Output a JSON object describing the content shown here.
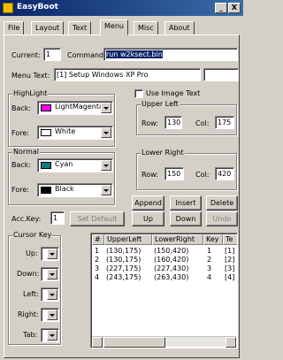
{
  "window": {
    "title": "EasyBoot",
    "minimize": "_",
    "close": "X"
  },
  "tabs": [
    "File",
    "Layout",
    "Text",
    "Menu",
    "Misc",
    "About"
  ],
  "current": {
    "label": "Current:",
    "value": "1"
  },
  "command": {
    "label": "Command:",
    "value": "run w2ksect.bin"
  },
  "menu_text": {
    "label": "Menu Text:",
    "value": "[1] Setup Windows XP Pro"
  },
  "highlight": {
    "title": "HighLight",
    "back_label": "Back:",
    "back_value": "LightMagenta",
    "back_color": "#ff00ff",
    "fore_label": "Fore:",
    "fore_value": "White",
    "fore_color": "#ffffff"
  },
  "use_image_text": {
    "label": "Use Image Text"
  },
  "upper_left": {
    "title": "Upper Left",
    "row_label": "Row:",
    "row_value": "130",
    "col_label": "Col:",
    "col_value": "175"
  },
  "normal": {
    "title": "Normal",
    "back_label": "Back:",
    "back_value": "Cyan",
    "back_color": "#008080",
    "fore_label": "Fore:",
    "fore_value": "Black",
    "fore_color": "#000000"
  },
  "lower_right": {
    "title": "Lower Right",
    "row_label": "Row:",
    "row_value": "150",
    "col_label": "Col:",
    "col_value": "420"
  },
  "buttons": {
    "append": "Append",
    "insert": "Insert",
    "delete": "Delete",
    "set_default": "Set Default",
    "up": "Up",
    "down": "Down",
    "undo": "Undo"
  },
  "acc_key": {
    "label": "Acc.Key:",
    "value": "1"
  },
  "cursor_key": {
    "title": "Cursor Key",
    "items": [
      {
        "label": "Up:"
      },
      {
        "label": "Down:"
      },
      {
        "label": "Left:"
      },
      {
        "label": "Right:"
      },
      {
        "label": "Tab:"
      }
    ]
  },
  "table": {
    "columns": [
      "#",
      "UpperLeft",
      "LowerRight",
      "Key",
      "Te"
    ],
    "rows": [
      [
        "1",
        "(130,175)",
        "(150,420)",
        "1",
        "[1] S"
      ],
      [
        "2",
        "(130,175)",
        "(160,420)",
        "2",
        "[2] S"
      ],
      [
        "3",
        "(227,175)",
        "(227,430)",
        "3",
        "[3] C"
      ],
      [
        "4",
        "(243,175)",
        "(263,430)",
        "4",
        "[4] B"
      ]
    ]
  }
}
